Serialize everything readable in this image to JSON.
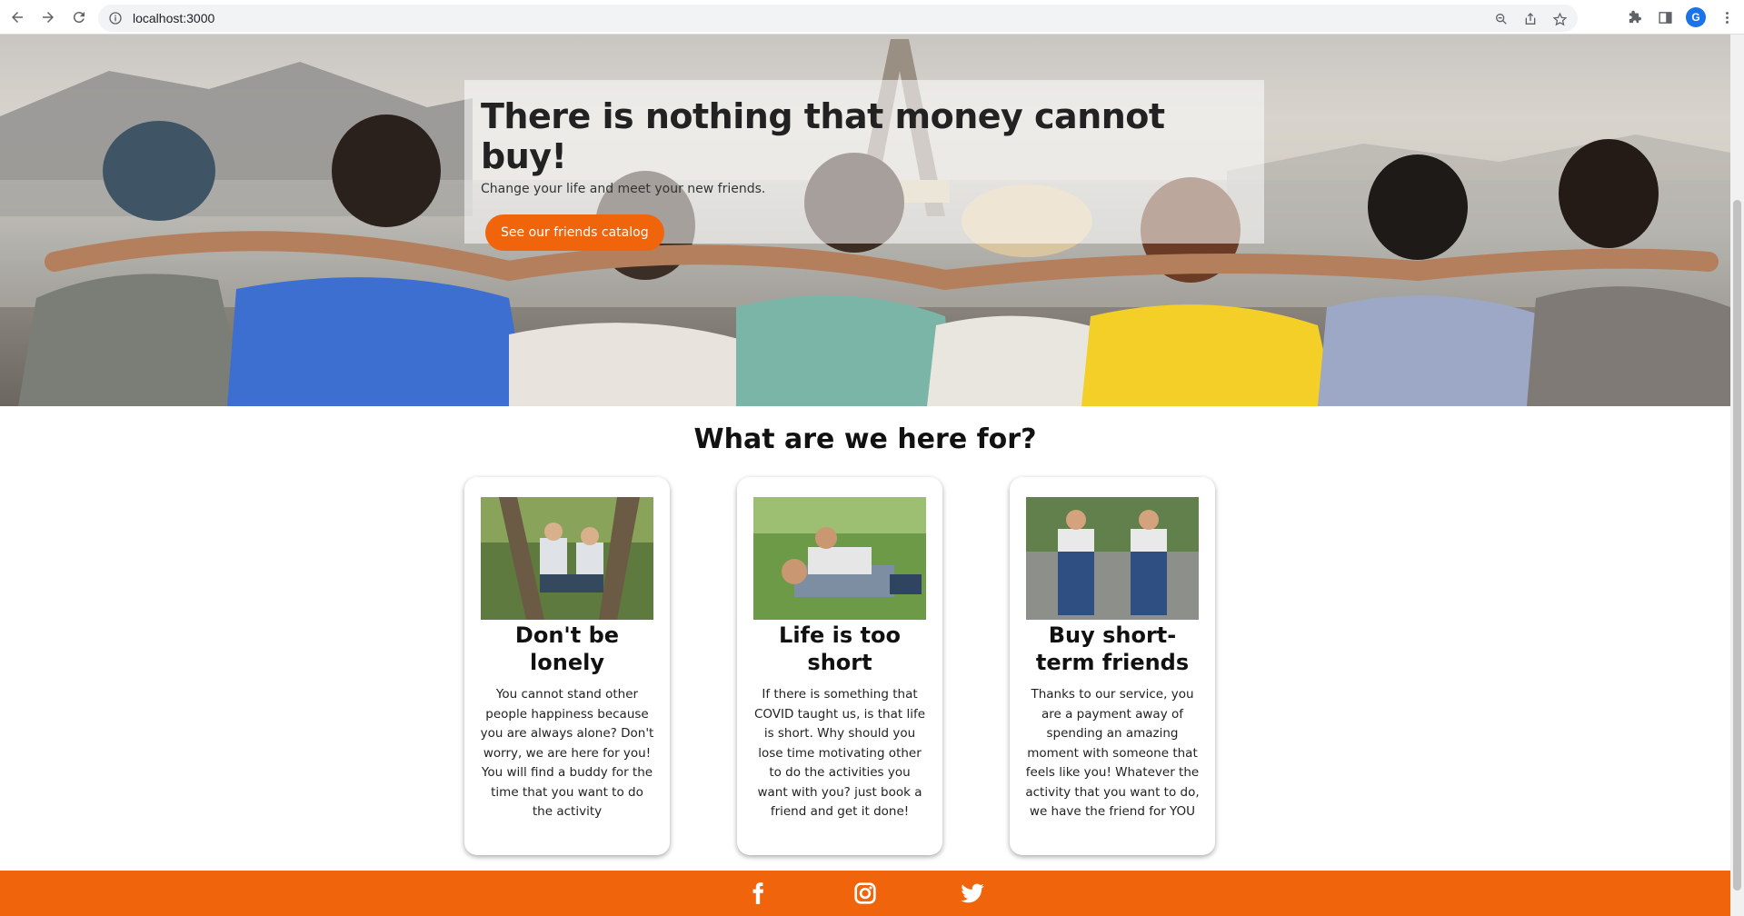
{
  "browser": {
    "url": "localhost:3000",
    "profile_initial": "G",
    "icons": [
      "back-icon",
      "forward-icon",
      "reload-icon",
      "info-icon",
      "zoom-icon",
      "share-icon",
      "star-icon",
      "extensions-icon",
      "sidepanel-icon",
      "menu-icon"
    ]
  },
  "hero": {
    "title": "There is nothing that money cannot buy!",
    "subtitle": "Change your life and meet your new friends.",
    "button_label": "See our friends catalog"
  },
  "section": {
    "title": "What are we here for?"
  },
  "cards": [
    {
      "title": "Don't be lonely",
      "text": "You cannot stand other people happiness because you are always alone? Don't worry, we are here for you! You will find a buddy for the time that you want to do the activity"
    },
    {
      "title": "Life is too short",
      "text": "If there is something that COVID taught us, is that life is short. Why should you lose time motivating other to do the activities you want with you? just book a friend and get it done!"
    },
    {
      "title": "Buy short-term friends",
      "text": "Thanks to our service, you are a payment away of spending an amazing moment with someone that feels like you! Whatever the activity that you want to do, we have the friend for YOU"
    }
  ],
  "footer": {
    "icons": [
      "facebook-icon",
      "instagram-icon",
      "twitter-icon"
    ]
  },
  "colors": {
    "accent": "#f0650c"
  }
}
